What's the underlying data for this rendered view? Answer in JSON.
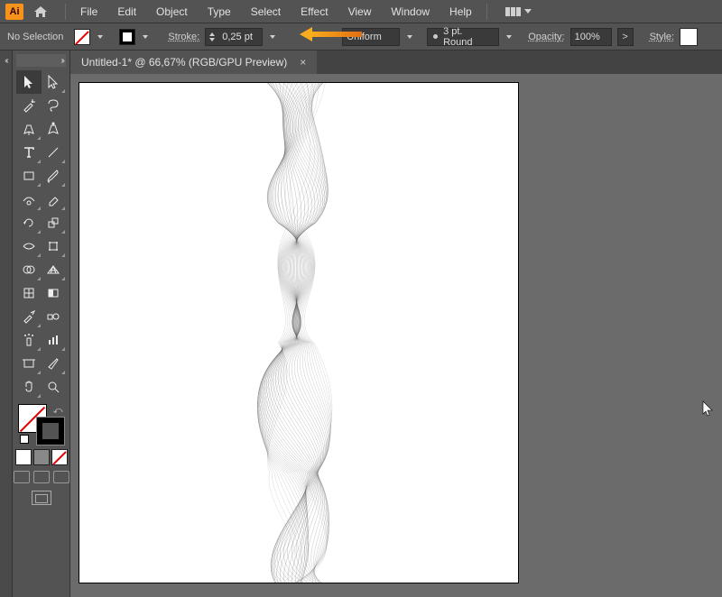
{
  "menu": {
    "items": [
      "File",
      "Edit",
      "Object",
      "Type",
      "Select",
      "Effect",
      "View",
      "Window",
      "Help"
    ]
  },
  "control": {
    "selection": "No Selection",
    "stroke_label": "Stroke:",
    "stroke_value": "0,25 pt",
    "variable_width": "Uniform",
    "brush_profile": "3 pt. Round",
    "opacity_label": "Opacity:",
    "opacity_value": "100%",
    "style_label": "Style:"
  },
  "tab": {
    "title": "Untitled-1* @ 66,67% (RGB/GPU Preview)"
  },
  "tools": {
    "row0": [
      "selection-tool",
      "direct-selection-tool"
    ],
    "row1": [
      "magic-wand-tool",
      "lasso-tool"
    ],
    "row2": [
      "pen-tool",
      "curvature-tool"
    ],
    "row3": [
      "type-tool",
      "line-segment-tool"
    ],
    "row4": [
      "rectangle-tool",
      "paintbrush-tool"
    ],
    "row5": [
      "shaper-tool",
      "eraser-tool"
    ],
    "row6": [
      "rotate-tool",
      "scale-tool"
    ],
    "row7": [
      "width-tool",
      "free-transform-tool"
    ],
    "row8": [
      "shape-builder-tool",
      "perspective-grid-tool"
    ],
    "row9": [
      "mesh-tool",
      "gradient-tool"
    ],
    "row10": [
      "eyedropper-tool",
      "blend-tool"
    ],
    "row11": [
      "symbol-sprayer-tool",
      "column-graph-tool"
    ],
    "row12": [
      "artboard-tool",
      "slice-tool"
    ],
    "row13": [
      "hand-tool",
      "zoom-tool"
    ]
  },
  "colors": {
    "accent": "#f7931a",
    "panel": "#535353",
    "panel_dark": "#434343",
    "canvas_bg": "#6b6b6b"
  }
}
